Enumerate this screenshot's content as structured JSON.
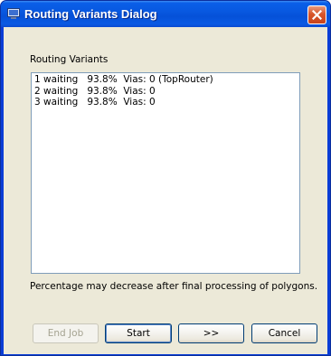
{
  "window": {
    "title": "Routing Variants Dialog"
  },
  "group": {
    "label": "Routing Variants"
  },
  "variants": [
    "1 waiting   93.8%  Vias: 0 (TopRouter)",
    "2 waiting   93.8%  Vias: 0",
    "3 waiting   93.8%  Vias: 0"
  ],
  "note": "Percentage may decrease after final processing of polygons.",
  "buttons": {
    "end_job": "End Job",
    "start": "Start",
    "next": ">>",
    "cancel": "Cancel"
  },
  "colors": {
    "titlebar": "#0858e0",
    "client": "#ece9d8",
    "close": "#d7552a"
  }
}
